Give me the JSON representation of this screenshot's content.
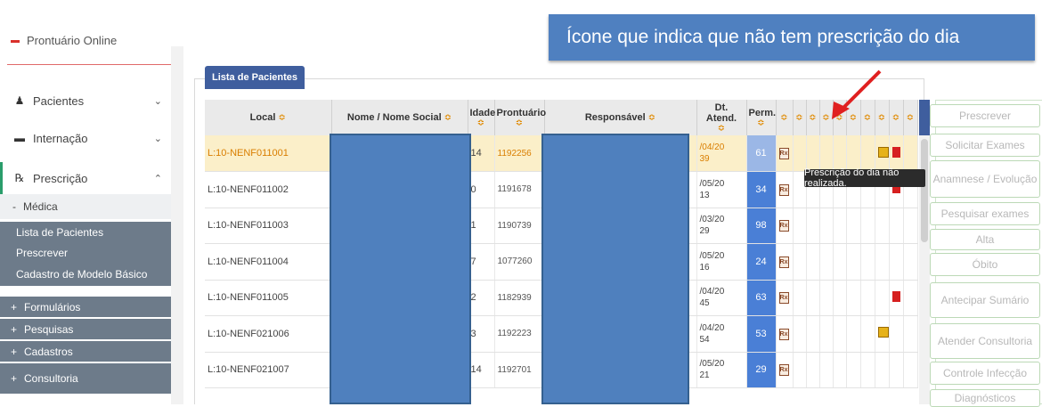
{
  "sidebar": {
    "top_item": "Prontuário Online",
    "items": [
      {
        "label": "Pacientes",
        "icon": "user-icon"
      },
      {
        "label": "Internação",
        "icon": "bed-icon"
      },
      {
        "label": "Prescrição",
        "icon": "rx-icon"
      }
    ],
    "sub_medica": "Médica",
    "dark_items": [
      "Lista de Pacientes",
      "Prescrever",
      "Cadastro de Modelo Básico",
      "Formulários",
      "Pesquisas",
      "Cadastros",
      "Consultoria"
    ]
  },
  "tab_label": "Lista de Pacientes",
  "columns": {
    "local": "Local",
    "nome": "Nome / Nome Social",
    "idade": "Idade",
    "prontuario": "Prontuário",
    "responsavel": "Responsável",
    "dt_atend": "Dt. Atend.",
    "perm": "Perm."
  },
  "sort_symbol": "≎",
  "rows": [
    {
      "local": "L:10-NENF011001",
      "idade": "14",
      "prontuario": "1192256",
      "dt1": "/04/20",
      "dt2": "39",
      "perm": "61"
    },
    {
      "local": "L:10-NENF011002",
      "idade": "0",
      "prontuario": "1191678",
      "dt1": "/05/20",
      "dt2": "13",
      "perm": "34"
    },
    {
      "local": "L:10-NENF011003",
      "idade": "1",
      "prontuario": "1190739",
      "dt1": "/03/20",
      "dt2": "29",
      "perm": "98"
    },
    {
      "local": "L:10-NENF011004",
      "idade": "7",
      "prontuario": "1077260",
      "dt1": "/05/20",
      "dt2": "16",
      "perm": "24"
    },
    {
      "local": "L:10-NENF011005",
      "idade": "2",
      "prontuario": "1182939",
      "dt1": "/04/20",
      "dt2": "45",
      "perm": "63"
    },
    {
      "local": "L:10-NENF021006",
      "idade": "3",
      "prontuario": "1192223",
      "dt1": "/04/20",
      "dt2": "54",
      "perm": "53"
    },
    {
      "local": "L:10-NENF021007",
      "idade": "14",
      "prontuario": "1192701",
      "dt1": "/05/20",
      "dt2": "21",
      "perm": "29"
    }
  ],
  "callout": "Ícone que indica que não tem prescrição do dia",
  "tooltip": "Prescrição do dia não realizada.",
  "actions": [
    "Prescrever",
    "Solicitar Exames",
    "Anamnese / Evolução",
    "Pesquisar exames",
    "Alta",
    "Óbito",
    "Antecipar Sumário",
    "Atender Consultoria",
    "Controle Infecção",
    "Diagnósticos"
  ],
  "colors": {
    "accent_blue": "#3f5e9e",
    "perm_blue": "#4a7fd6",
    "selected_row": "#fbefc9",
    "sidebar_dark": "#6d7b8a",
    "arrow_red": "#e02020"
  }
}
